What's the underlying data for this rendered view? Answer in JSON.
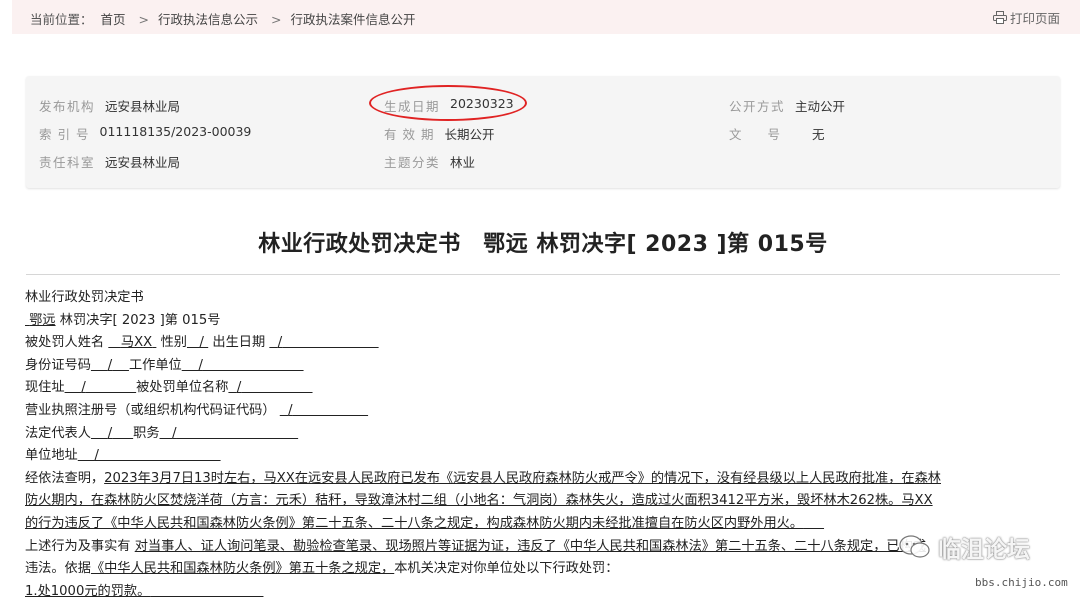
{
  "breadcrumb": {
    "prefix": "当前位置：",
    "items": [
      "首页",
      "行政执法信息公示",
      "行政执法案件信息公开"
    ],
    "sep": ">"
  },
  "print": {
    "label": "打印页面",
    "icon": "printer-icon"
  },
  "meta": {
    "publisher_label": "发布机构",
    "publisher": "远安县林业局",
    "date_label": "生成日期",
    "date": "20230323",
    "open_mode_label": "公开方式",
    "open_mode": "主动公开",
    "index_label": "索引号",
    "index": "011118135/2023-00039",
    "validity_label": "有效期",
    "validity": "长期公开",
    "docno_label": "文号",
    "docno": "无",
    "dept_label": "责任科室",
    "dept": "远安县林业局",
    "topic_label": "主题分类",
    "topic": "林业",
    "highlight_color": "#e02323"
  },
  "doc": {
    "title": "林业行政处罚决定书　鄂远 林罚决字[ 2023 ]第 015号",
    "lines": {
      "l1": "林业行政处罚决定书",
      "l2a": "鄂远",
      "l2b": " 林罚决字[ 2023 ]第 015号",
      "l3a": "被处罚人姓名",
      "l3b": "马XX",
      "l3c": "性别",
      "l3d": "/",
      "l3e": "出生日期",
      "l3f": "/",
      "l4a": "身份证号码",
      "l4b": "/",
      "l4c": "工作单位",
      "l4d": "/",
      "l5a": "现住址",
      "l5b": "/",
      "l5c": "被处罚单位名称",
      "l5d": "/",
      "l6a": "营业执照注册号（或组织机构代码证代码）",
      "l6b": "/",
      "l7a": "法定代表人",
      "l7b": "/",
      "l7c": "职务",
      "l7d": "/",
      "l8a": "单位地址",
      "l8b": "/",
      "l9a": "经依法查明，",
      "l9b": "2023年3月7日13时左右，马XX在远安县人民政府已发布《远安县人民政府森林防火戒严令》的情况下，没有经县级以上人民政府批准，在森林",
      "l10": "防火期内，在森林防火区焚烧洋荷（方言：元禾）秸秆，导致漳沐村二组（小地名：气洞岗）森林失火，造成过火面积3412平方米，毁坏林木262株。马XX",
      "l11": "的行为违反了《中华人民共和国森林防火条例》第二十五条、二十八条之规定，构成森林防火期内未经批准擅自在防火区内野外用火。",
      "l12a": "上述行为及事实有 ",
      "l12b": "对当事人、证人询问笔录、勘验检查笔录、现场照片等证据为证，违反了《中华人民共和国森林法》第二十五条、二十八条规定，已构成",
      "l13a": "违法。依据",
      "l13b": "《中华人民共和国森林防火条例》第五十条之规定，",
      "l13c": "本机关决定对你单位处以下行政处罚：",
      "l14": "1.处1000元的罚款。"
    }
  },
  "watermark": {
    "text": "临沮论坛",
    "url": "bbs.chijio.com"
  }
}
